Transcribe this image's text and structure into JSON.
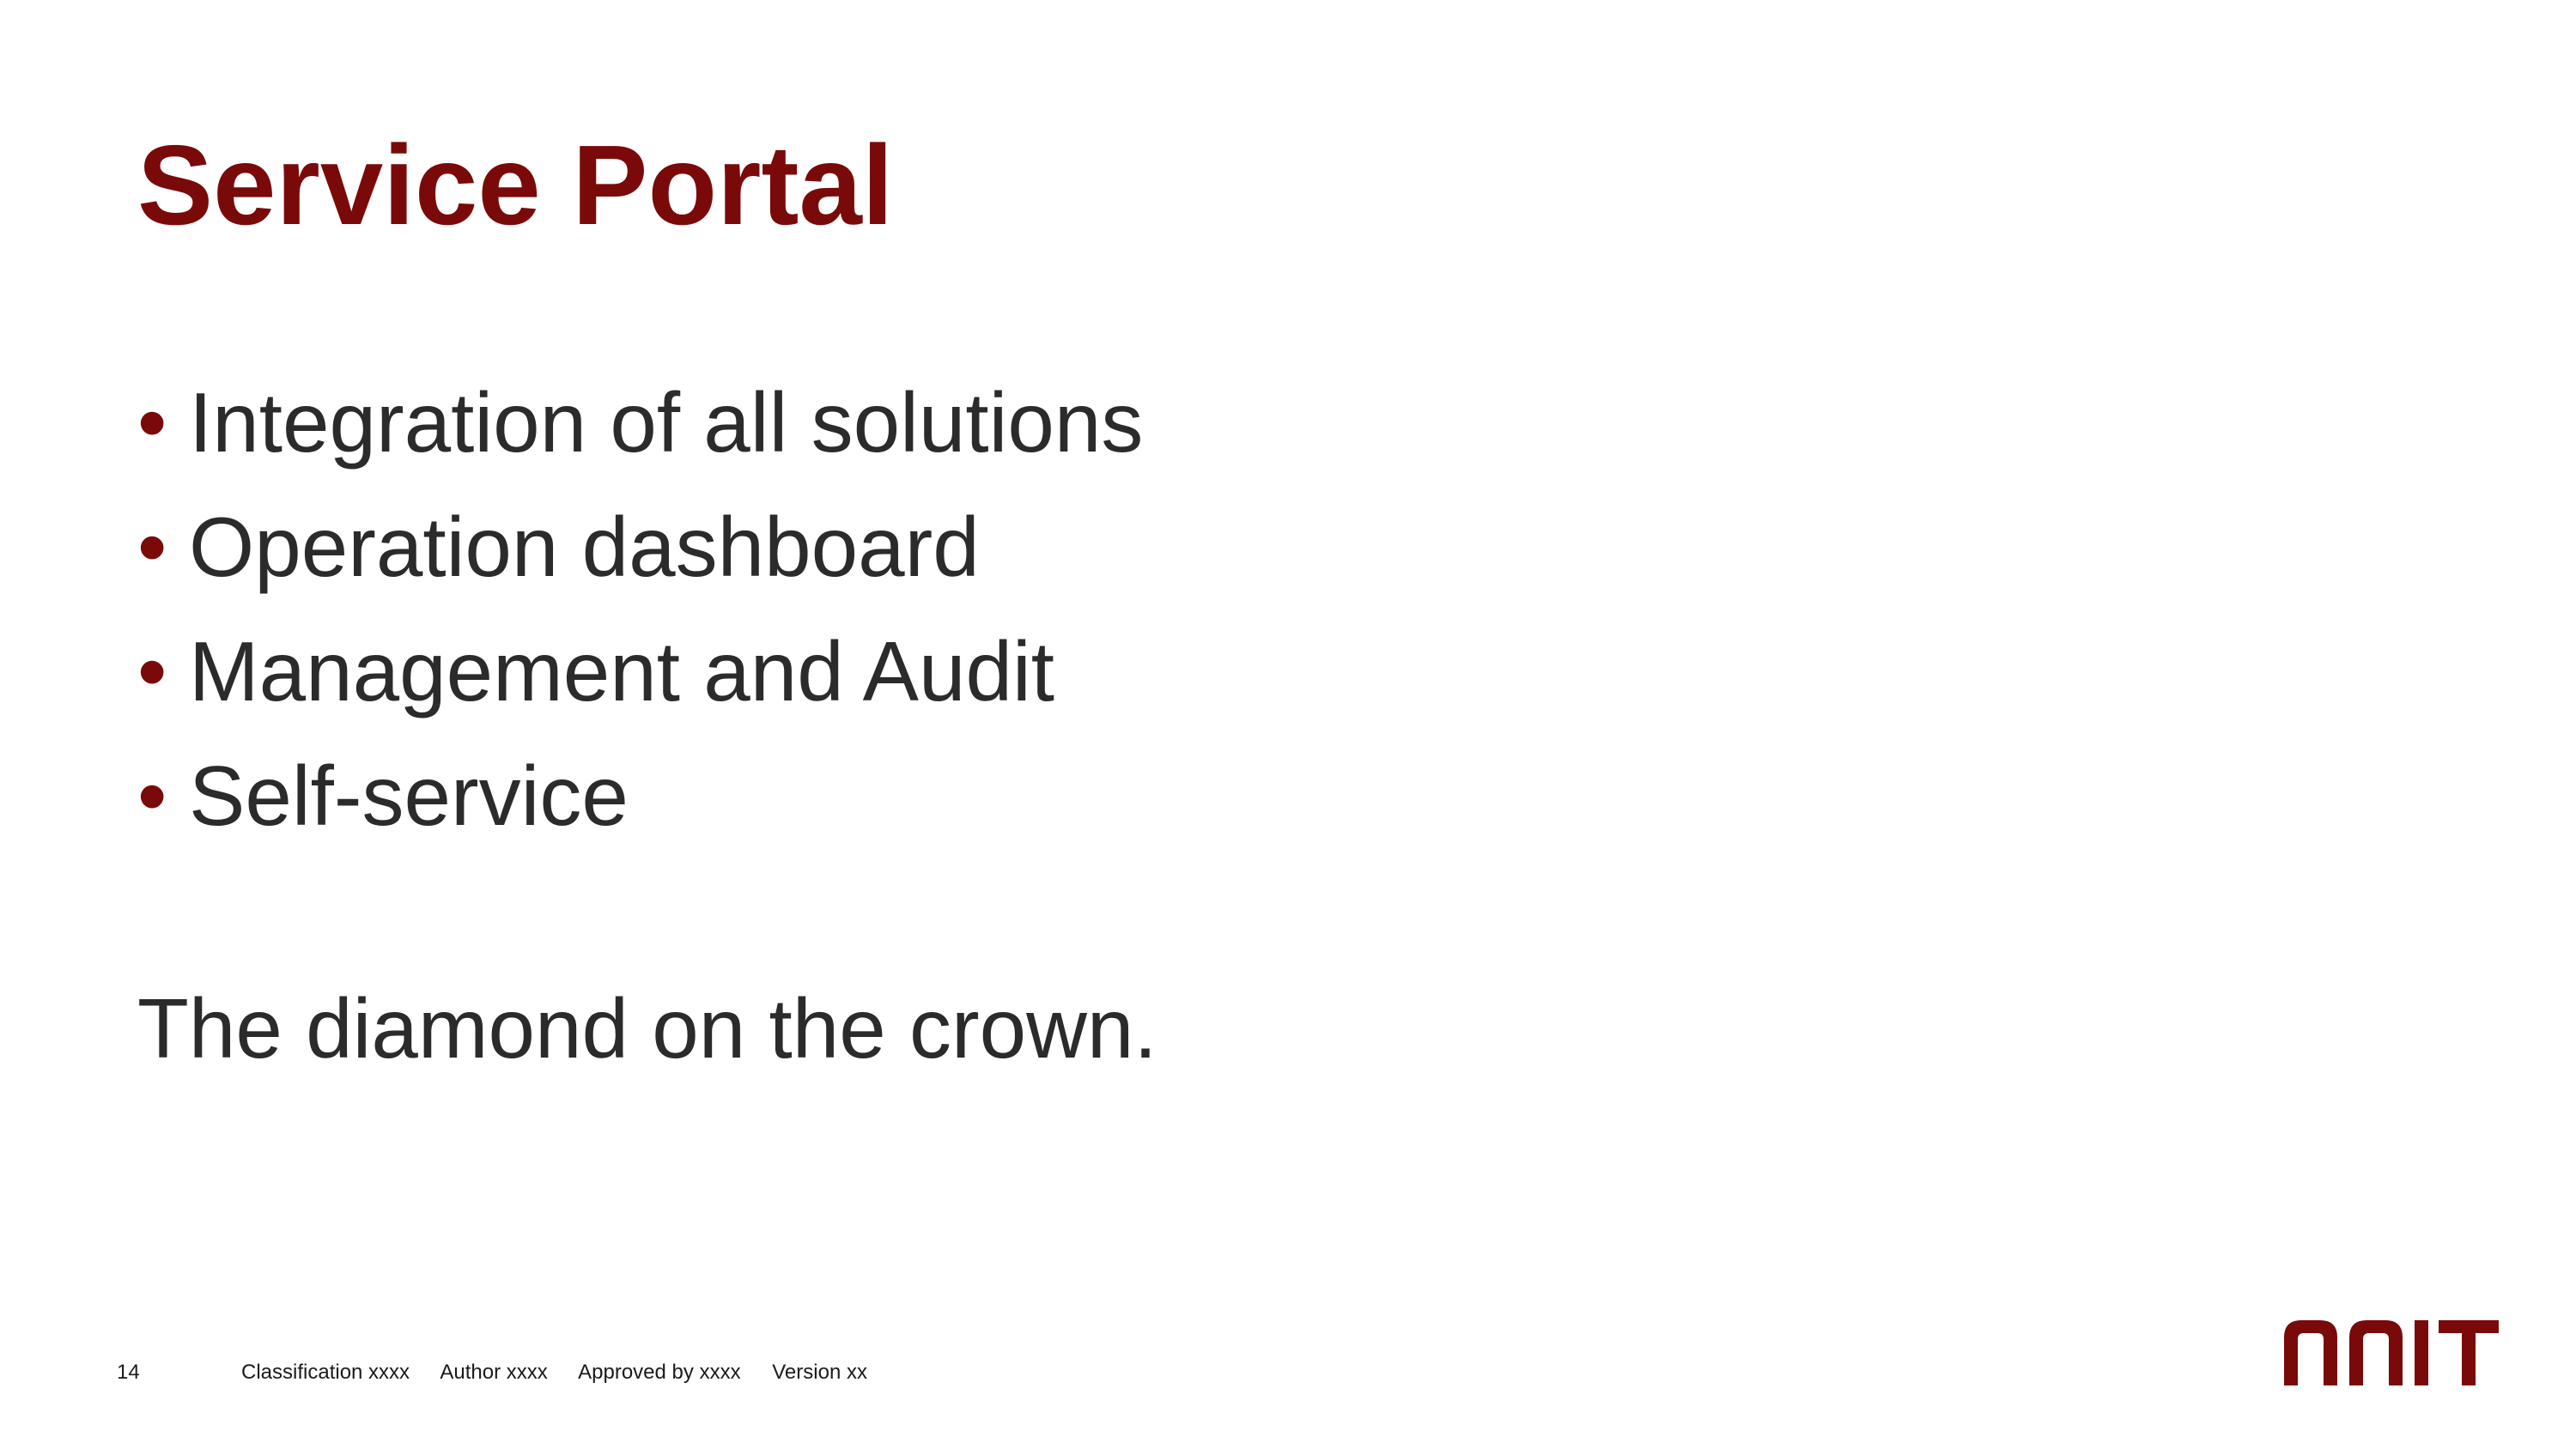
{
  "slide": {
    "title": "Service Portal",
    "bullets": [
      "Integration of all solutions",
      "Operation dashboard",
      "Management and Audit",
      "Self-service"
    ],
    "tagline": "The diamond on the crown.",
    "bullet_symbol": "•",
    "accent_color": "#7a0a0a",
    "text_color": "#2b2b2b"
  },
  "footer": {
    "page_number": "14",
    "classification": "Classification xxxx",
    "author": "Author xxxx",
    "approved_by": "Approved by xxxx",
    "version": "Version xx"
  },
  "logo": {
    "text": "NNIT",
    "icon": "nnit-logo"
  }
}
